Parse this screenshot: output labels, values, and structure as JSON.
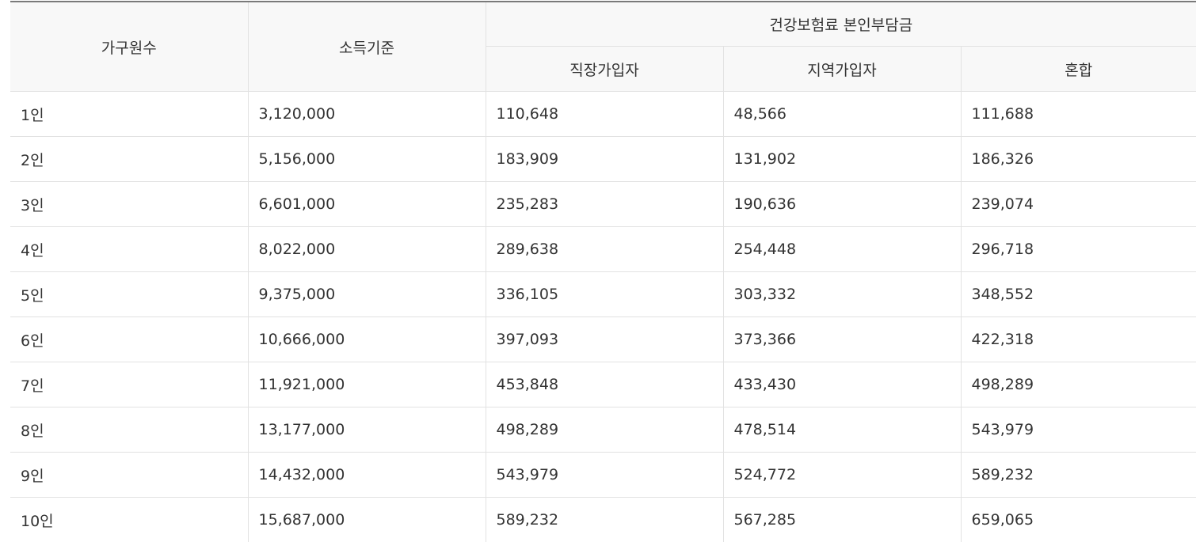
{
  "table": {
    "headers": {
      "household": "가구원수",
      "income": "소득기준",
      "premium_group": "건강보험료 본인부담금",
      "workplace": "직장가입자",
      "regional": "지역가입자",
      "mixed": "혼합"
    },
    "rows": [
      [
        "1인",
        "3,120,000",
        "110,648",
        "48,566",
        "111,688"
      ],
      [
        "2인",
        "5,156,000",
        "183,909",
        "131,902",
        "186,326"
      ],
      [
        "3인",
        "6,601,000",
        "235,283",
        "190,636",
        "239,074"
      ],
      [
        "4인",
        "8,022,000",
        "289,638",
        "254,448",
        "296,718"
      ],
      [
        "5인",
        "9,375,000",
        "336,105",
        "303,332",
        "348,552"
      ],
      [
        "6인",
        "10,666,000",
        "397,093",
        "373,366",
        "422,318"
      ],
      [
        "7인",
        "11,921,000",
        "453,848",
        "433,430",
        "498,289"
      ],
      [
        "8인",
        "13,177,000",
        "498,289",
        "478,514",
        "543,979"
      ],
      [
        "9인",
        "14,432,000",
        "543,979",
        "524,772",
        "589,232"
      ],
      [
        "10인",
        "15,687,000",
        "589,232",
        "567,285",
        "659,065"
      ]
    ]
  }
}
